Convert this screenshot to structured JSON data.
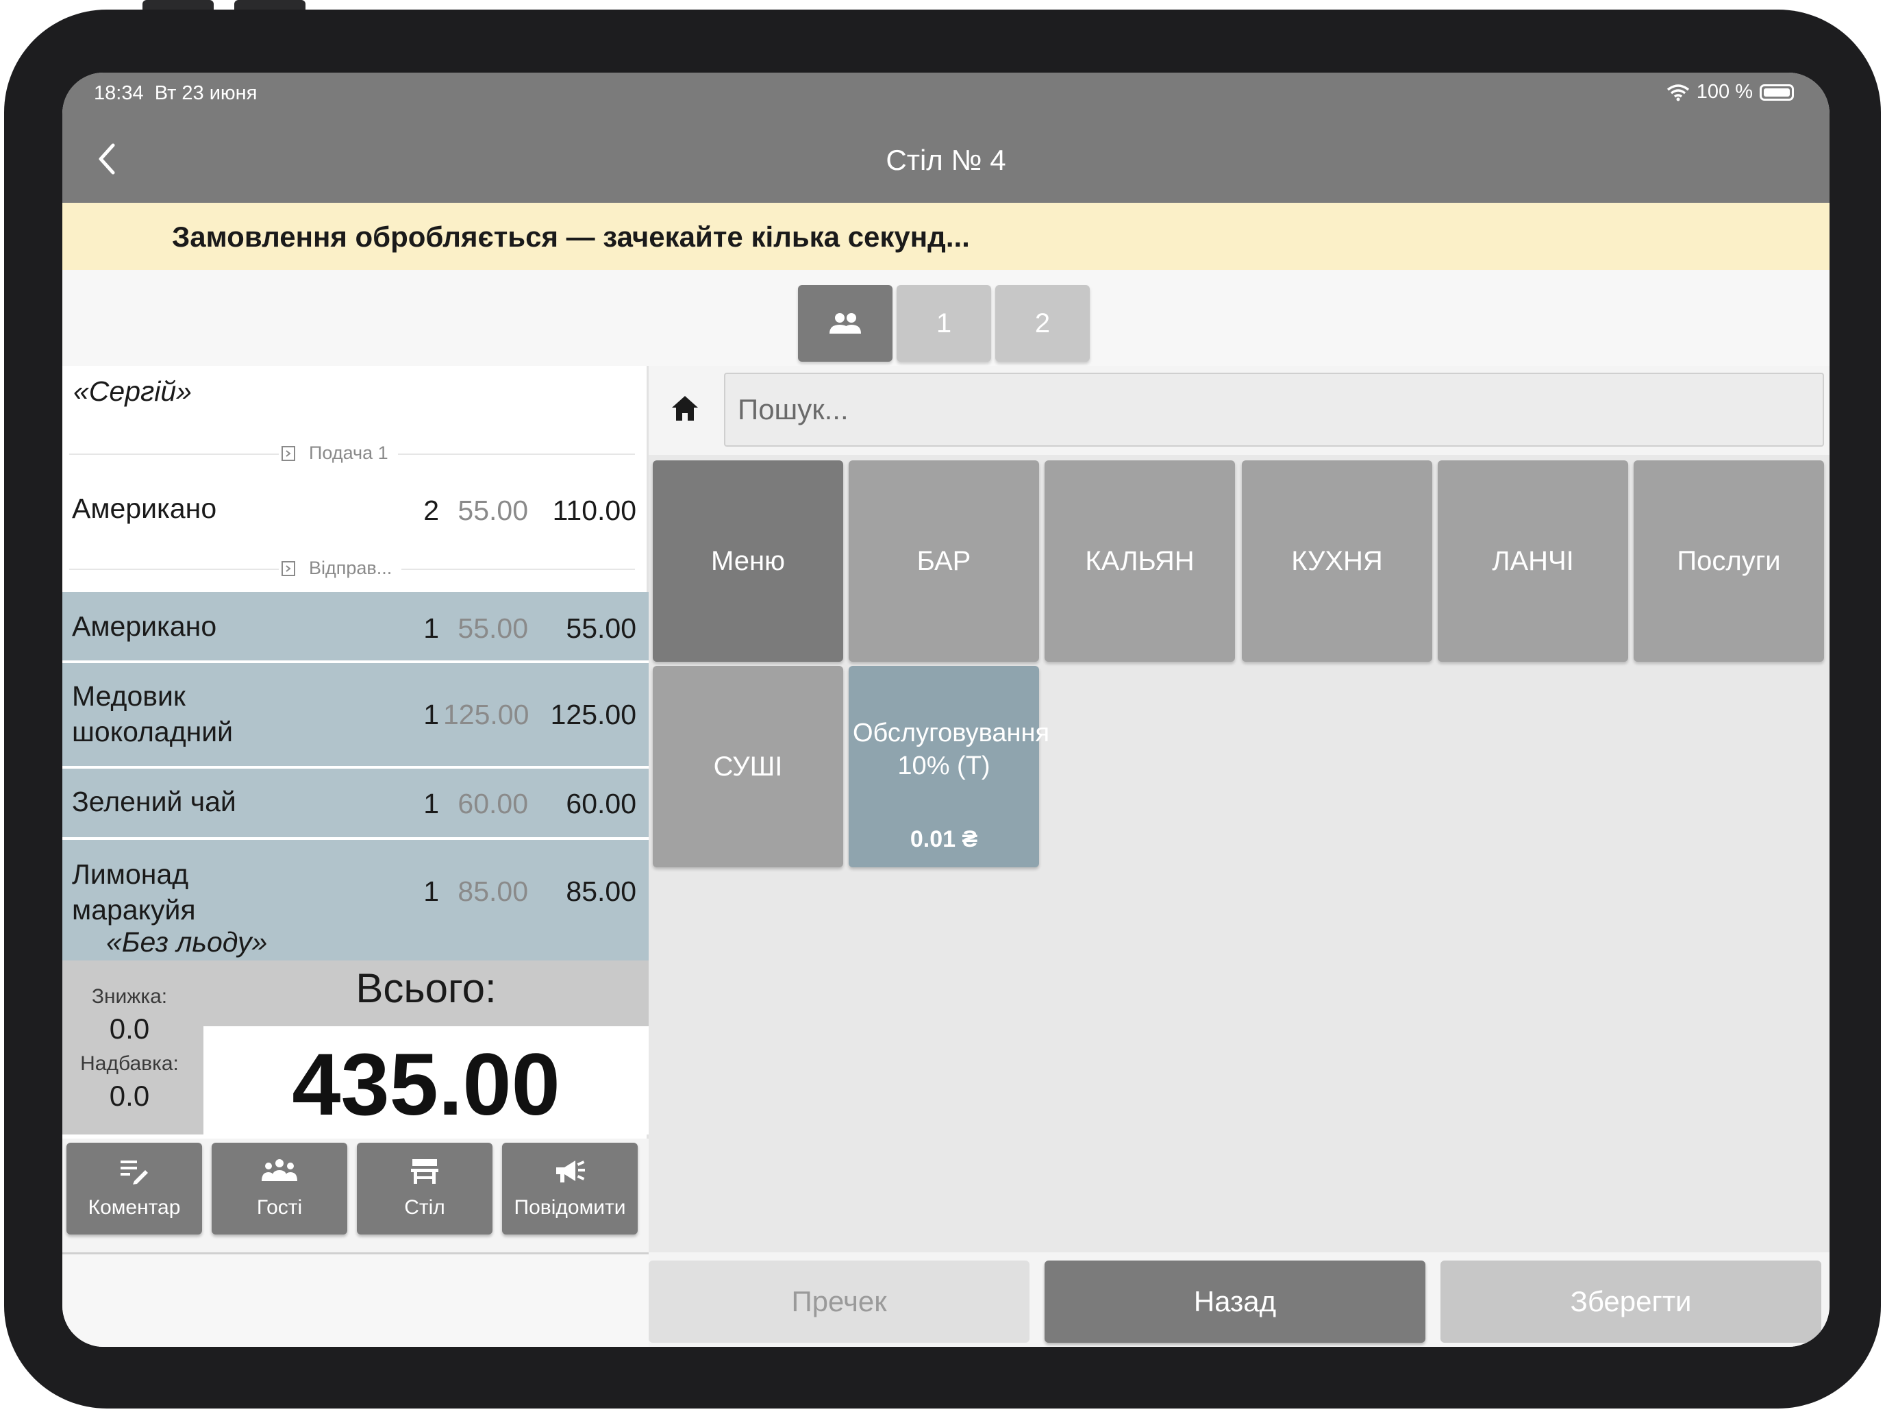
{
  "status": {
    "time": "18:34",
    "date": "Вт 23 июня",
    "battery": "100 %"
  },
  "header": {
    "title": "Стіл № 4"
  },
  "notice": "Замовлення обробляється — зачекайте кілька секунд...",
  "guest_tabs": [
    {
      "label": "",
      "icon": "people-icon",
      "active": true
    },
    {
      "label": "1",
      "active": false
    },
    {
      "label": "2",
      "active": false
    }
  ],
  "order": {
    "guest_name": "«Сергій»",
    "groups": [
      {
        "label": "Подача 1"
      },
      {
        "label": "Відправ..."
      }
    ],
    "items": [
      {
        "name": "Американо",
        "qty": "2",
        "price": "55.00",
        "total": "110.00"
      },
      {
        "name": "Американо",
        "qty": "1",
        "price": "55.00",
        "total": "55.00"
      },
      {
        "name": "Медовик шоколадний",
        "qty": "1",
        "price": "125.00",
        "total": "125.00"
      },
      {
        "name": "Зелений чай",
        "qty": "1",
        "price": "60.00",
        "total": "60.00"
      },
      {
        "name": "Лимонад маракуйя",
        "qty": "1",
        "price": "85.00",
        "total": "85.00",
        "comment": "«Без льоду»"
      }
    ]
  },
  "totals": {
    "discount_label": "Знижка:",
    "discount_value": "0.0",
    "surcharge_label": "Надбавка:",
    "surcharge_value": "0.0",
    "total_label": "Всього:",
    "total_value": "435.00"
  },
  "actions": [
    {
      "label": "Коментар",
      "icon": "comment-edit-icon"
    },
    {
      "label": "Гості",
      "icon": "guests-icon"
    },
    {
      "label": "Стіл",
      "icon": "table-icon"
    },
    {
      "label": "Повідомити",
      "icon": "megaphone-icon"
    }
  ],
  "search": {
    "placeholder": "Пошук..."
  },
  "categories": [
    {
      "label": "Меню"
    },
    {
      "label": "БАР"
    },
    {
      "label": "КАЛЬЯН"
    },
    {
      "label": "КУХНЯ"
    },
    {
      "label": "ЛАНЧІ"
    },
    {
      "label": "Послуги"
    },
    {
      "label": "СУШІ"
    }
  ],
  "product": {
    "name": "Обслуговування 10% (Т)",
    "price": "0.01 ₴"
  },
  "bottom_buttons": {
    "precheck": "Пречек",
    "back": "Назад",
    "save": "Зберегти"
  },
  "colors": {
    "header": "#7b7b7b",
    "notice_bg": "#fbf0c8",
    "sent_row": "#b1c3cb",
    "product_tile": "#8fa4ae"
  }
}
